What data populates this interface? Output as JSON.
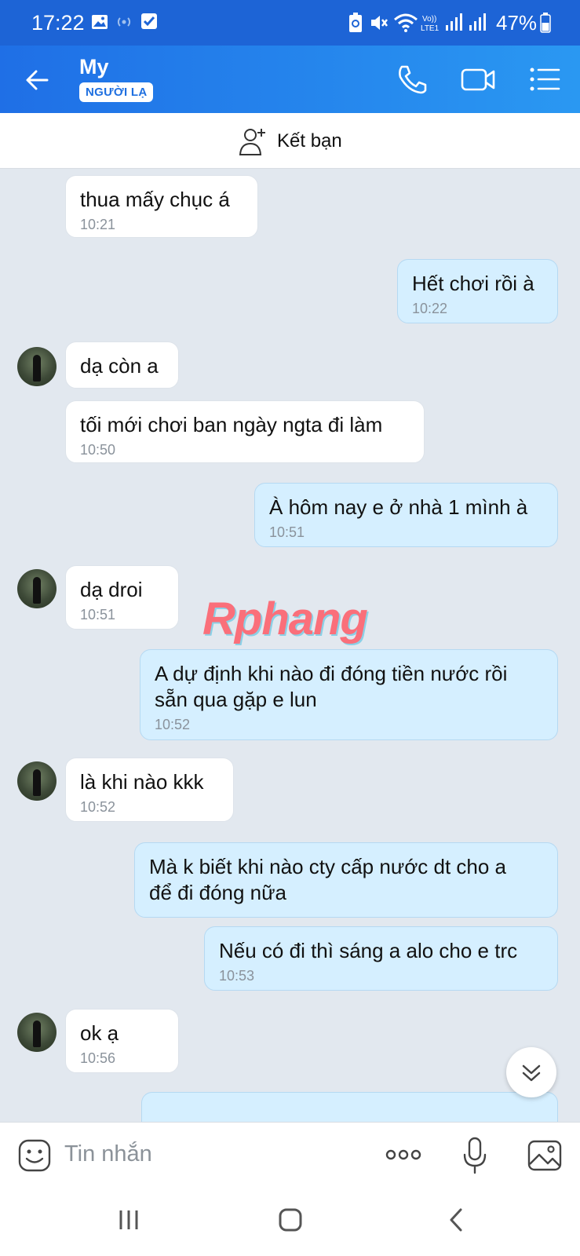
{
  "status_bar": {
    "time": "17:22",
    "battery": "47%",
    "icons": [
      "gallery-icon",
      "hotspot-icon",
      "checkbox-icon",
      "battery-saver-icon",
      "mute-icon",
      "wifi-icon",
      "volte-icon",
      "signal-icon",
      "signal-icon",
      "battery-icon"
    ]
  },
  "header": {
    "contact_name": "My",
    "badge": "NGƯỜI LẠ",
    "icons": [
      "back-arrow-icon",
      "phone-icon",
      "video-call-icon",
      "menu-list-icon"
    ]
  },
  "add_friend": {
    "label": "Kết bạn",
    "icon": "add-friend-icon"
  },
  "messages": [
    {
      "dir": "in",
      "text": "thua mấy chục á",
      "time": "10:21"
    },
    {
      "dir": "out",
      "text": "Hết chơi rồi à",
      "time": "10:22"
    },
    {
      "dir": "in",
      "text": "dạ còn a",
      "time": ""
    },
    {
      "dir": "in",
      "text": "tối mới chơi ban ngày ngta đi làm",
      "time": "10:50"
    },
    {
      "dir": "out",
      "text": "À hôm nay e ở nhà 1 mình à",
      "time": "10:51"
    },
    {
      "dir": "in",
      "text": "dạ droi",
      "time": "10:51"
    },
    {
      "dir": "out",
      "text_lines": [
        "A dự định khi nào đi đóng tiền nước rồi",
        "sẵn qua gặp e lun"
      ],
      "time": "10:52"
    },
    {
      "dir": "in",
      "text": "là khi nào kkk",
      "time": "10:52"
    },
    {
      "dir": "out",
      "text_lines": [
        "Mà k biết khi nào cty cấp nước dt cho a",
        "để đi đóng nữa"
      ],
      "time": ""
    },
    {
      "dir": "out",
      "text": "Nếu có đi thì sáng a alo cho e trc",
      "time": "10:53"
    },
    {
      "dir": "in",
      "text": "ok ạ",
      "time": "10:56"
    }
  ],
  "watermark": "Rphang",
  "input": {
    "placeholder": "Tin nhắn",
    "icons": [
      "emoji-icon",
      "more-icon",
      "microphone-icon",
      "image-icon"
    ]
  },
  "navbar": {
    "icons": [
      "recent-apps-icon",
      "home-icon",
      "back-icon"
    ]
  },
  "colors": {
    "status_bar": "#1d64d6",
    "header_start": "#1f6fe6",
    "header_end": "#2a98f2",
    "chat_bg": "#e2e8ef",
    "incoming_bubble": "#ffffff",
    "outgoing_bubble": "#d5efff"
  }
}
